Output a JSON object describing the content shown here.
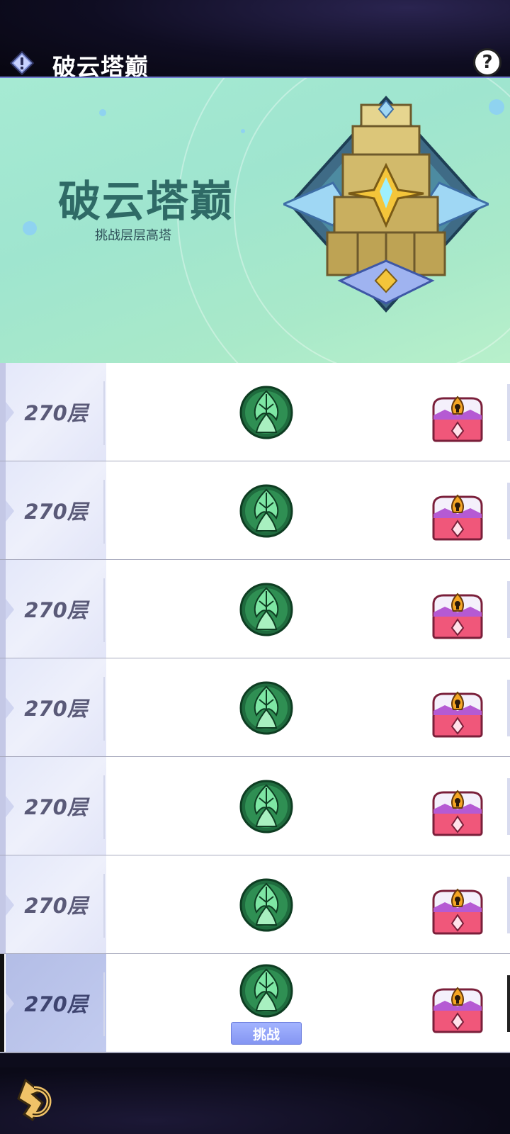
{
  "header": {
    "title": "破云塔巅",
    "info_icon": "exclamation-diamond-icon",
    "help_label": "?"
  },
  "banner": {
    "title": "破云塔巅",
    "subtitle": "挑战层层高塔",
    "emblem": "tower-emblem-icon"
  },
  "floors": [
    {
      "label": "270层",
      "enemy_icon": "green-leaf-emblem-icon",
      "reward_icon": "treasure-chest-icon"
    },
    {
      "label": "270层",
      "enemy_icon": "green-leaf-emblem-icon",
      "reward_icon": "treasure-chest-icon"
    },
    {
      "label": "270层",
      "enemy_icon": "green-leaf-emblem-icon",
      "reward_icon": "treasure-chest-icon"
    },
    {
      "label": "270层",
      "enemy_icon": "green-leaf-emblem-icon",
      "reward_icon": "treasure-chest-icon"
    },
    {
      "label": "270层",
      "enemy_icon": "green-leaf-emblem-icon",
      "reward_icon": "treasure-chest-icon"
    },
    {
      "label": "270层",
      "enemy_icon": "green-leaf-emblem-icon",
      "reward_icon": "treasure-chest-icon"
    },
    {
      "label": "270层",
      "enemy_icon": "green-leaf-emblem-icon",
      "reward_icon": "treasure-chest-icon",
      "action_label": "挑战"
    }
  ],
  "footer": {
    "back_icon": "back-arrow-icon"
  },
  "colors": {
    "banner_bg": "#a6ead3",
    "title_teal": "#2f6a66",
    "active_row": "#b3bde6",
    "challenge_button": "#8ea0f8"
  }
}
